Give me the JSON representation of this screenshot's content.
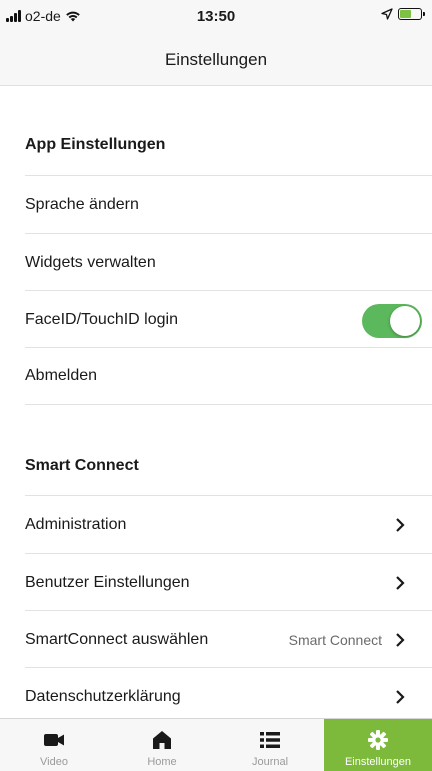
{
  "status_bar": {
    "carrier": "o2-de",
    "time": "13:50",
    "battery_level": 0.6
  },
  "header": {
    "title": "Einstellungen"
  },
  "sections": [
    {
      "heading": "App Einstellungen",
      "rows": [
        {
          "label": "Sprache ändern"
        },
        {
          "label": "Widgets verwalten"
        },
        {
          "label": "FaceID/TouchID login",
          "toggle": true
        },
        {
          "label": "Abmelden"
        }
      ]
    },
    {
      "heading": "Smart Connect",
      "rows": [
        {
          "label": "Administration",
          "chevron": true
        },
        {
          "label": "Benutzer Einstellungen",
          "chevron": true
        },
        {
          "label": "SmartConnect auswählen",
          "value": "Smart Connect",
          "chevron": true
        },
        {
          "label": "Datenschutzerklärung",
          "chevron": true
        }
      ]
    }
  ],
  "tabs": [
    {
      "label": "Video",
      "icon": "video-camera-icon"
    },
    {
      "label": "Home",
      "icon": "home-icon"
    },
    {
      "label": "Journal",
      "icon": "list-icon"
    },
    {
      "label": "Einstellungen",
      "icon": "gear-icon",
      "active": true
    }
  ],
  "colors": {
    "accent": "#7dba3c",
    "toggle_on": "#5cb85c"
  }
}
